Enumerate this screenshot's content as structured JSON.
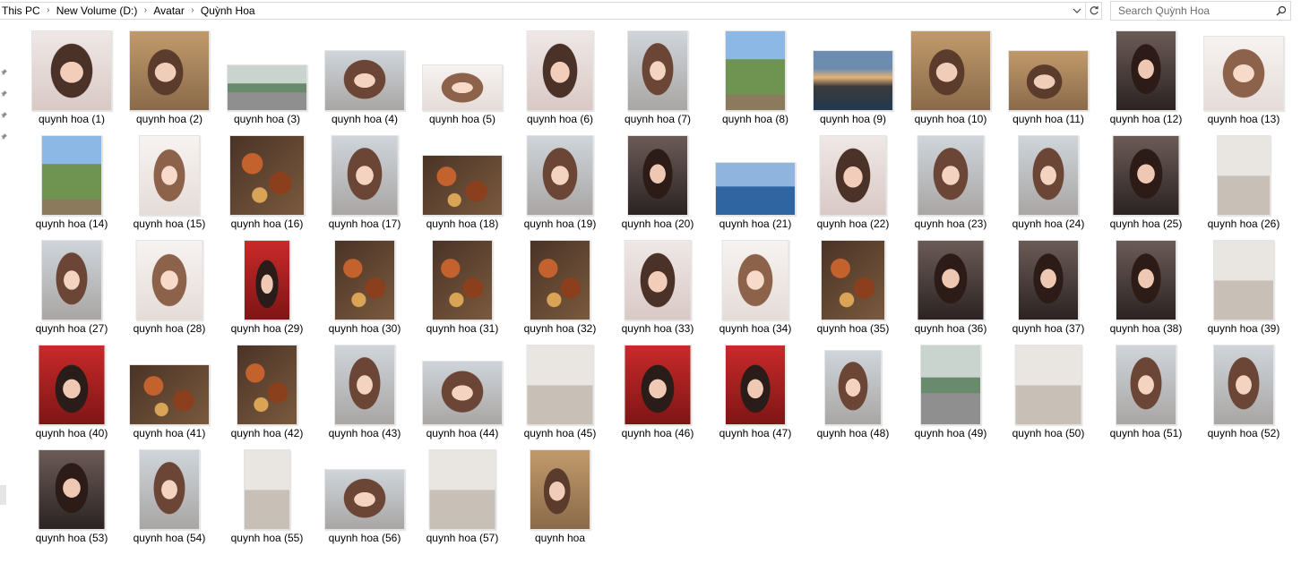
{
  "address_bar": {
    "breadcrumbs": [
      "This PC",
      "New Volume (D:)",
      "Avatar",
      "Quỳnh Hoa"
    ],
    "dropdown_icon": "chevron-down-icon",
    "refresh_icon": "refresh-icon"
  },
  "search": {
    "placeholder": "Search Quỳnh Hoa",
    "icon": "search-icon"
  },
  "files": [
    "quynh hoa (1)",
    "quynh hoa (2)",
    "quynh hoa (3)",
    "quynh hoa (4)",
    "quynh hoa (5)",
    "quynh hoa (6)",
    "quynh hoa (7)",
    "quynh hoa (8)",
    "quynh hoa (9)",
    "quynh hoa (10)",
    "quynh hoa (11)",
    "quynh hoa (12)",
    "quynh hoa (13)",
    "quynh hoa (14)",
    "quynh hoa (15)",
    "quynh hoa (16)",
    "quynh hoa (17)",
    "quynh hoa (18)",
    "quynh hoa (19)",
    "quynh hoa (20)",
    "quynh hoa (21)",
    "quynh hoa (22)",
    "quynh hoa (23)",
    "quynh hoa (24)",
    "quynh hoa (25)",
    "quynh hoa (26)",
    "quynh hoa (27)",
    "quynh hoa (28)",
    "quynh hoa (29)",
    "quynh hoa (30)",
    "quynh hoa (31)",
    "quynh hoa (32)",
    "quynh hoa (33)",
    "quynh hoa (34)",
    "quynh hoa (35)",
    "quynh hoa (36)",
    "quynh hoa (37)",
    "quynh hoa (38)",
    "quynh hoa (39)",
    "quynh hoa (40)",
    "quynh hoa (41)",
    "quynh hoa (42)",
    "quynh hoa (43)",
    "quynh hoa (44)",
    "quynh hoa (45)",
    "quynh hoa (46)",
    "quynh hoa (47)",
    "quynh hoa (48)",
    "quynh hoa (49)",
    "quynh hoa (50)",
    "quynh hoa (51)",
    "quynh hoa (52)",
    "quynh hoa (53)",
    "quynh hoa (54)",
    "quynh hoa (55)",
    "quynh hoa (56)",
    "quynh hoa (57)",
    "quynh hoa"
  ],
  "colors": {
    "border": "#d9d9d9",
    "search_text": "#6d6d6d"
  }
}
